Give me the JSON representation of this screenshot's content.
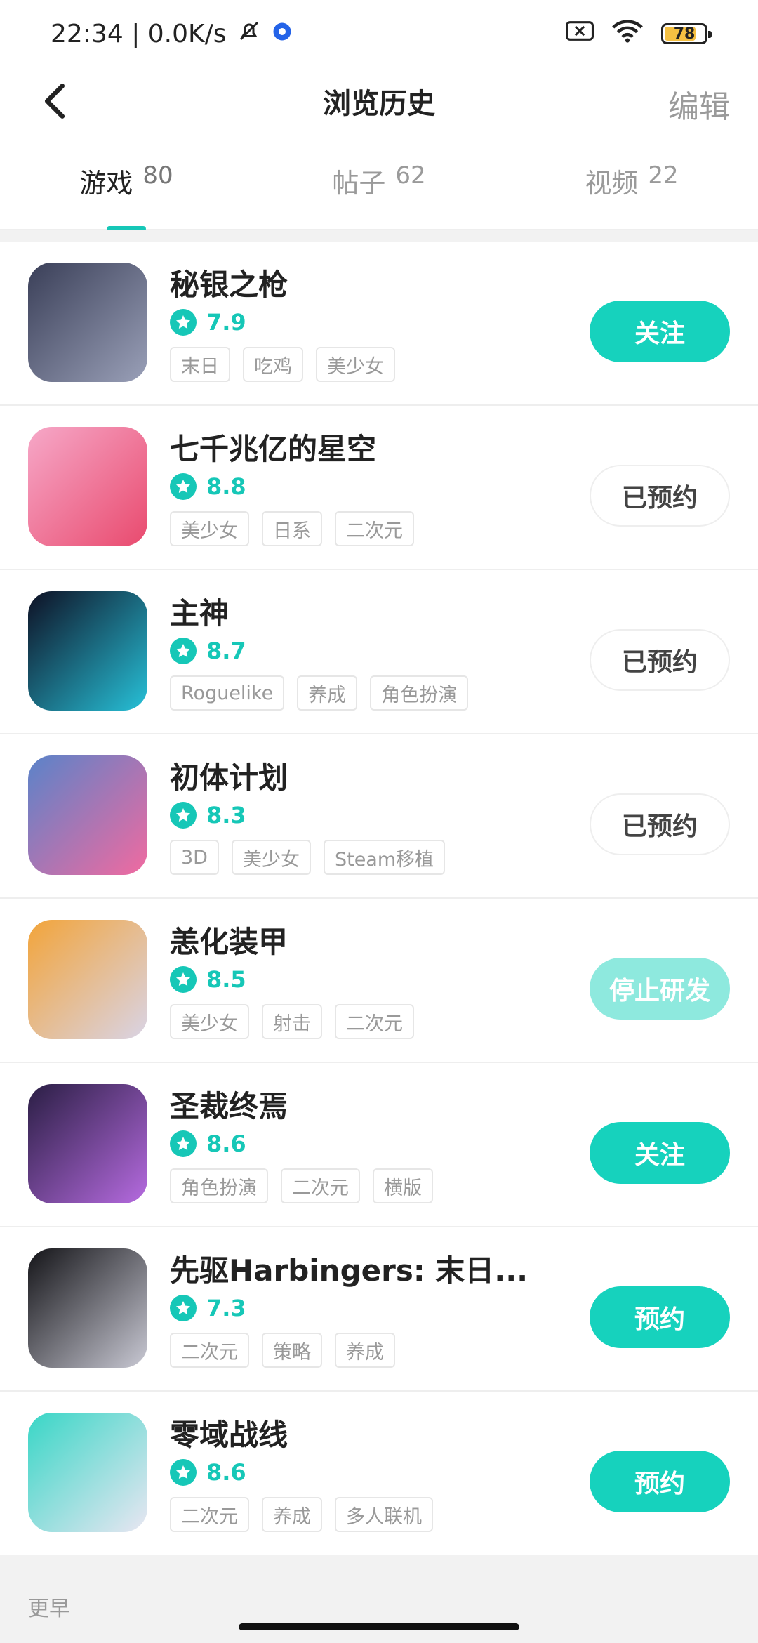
{
  "status_bar": {
    "time_speed": "22:34 | 0.0K/s",
    "battery_level": "78",
    "battery_fraction": 0.78
  },
  "nav": {
    "title": "浏览历史",
    "edit_label": "编辑"
  },
  "tabs": [
    {
      "label": "游戏",
      "count": "80"
    },
    {
      "label": "帖子",
      "count": "62"
    },
    {
      "label": "视频",
      "count": "22"
    }
  ],
  "games": [
    {
      "name": "秘银之枪",
      "rating": "7.9",
      "tags": [
        "末日",
        "吃鸡",
        "美少女"
      ],
      "action": "关注",
      "action_style": "primary",
      "icon_colors": [
        "#3a3f58",
        "#9aa0b8"
      ]
    },
    {
      "name": "七千兆亿的星空",
      "rating": "8.8",
      "tags": [
        "美少女",
        "日系",
        "二次元"
      ],
      "action": "已预约",
      "action_style": "reserved",
      "icon_colors": [
        "#f6a8c8",
        "#e94a6e"
      ]
    },
    {
      "name": "主神",
      "rating": "8.7",
      "tags": [
        "Roguelike",
        "养成",
        "角色扮演"
      ],
      "action": "已预约",
      "action_style": "reserved",
      "icon_colors": [
        "#0e1024",
        "#27c1d8"
      ]
    },
    {
      "name": "初体计划",
      "rating": "8.3",
      "tags": [
        "3D",
        "美少女",
        "Steam移植"
      ],
      "action": "已预约",
      "action_style": "reserved",
      "icon_colors": [
        "#5a83c9",
        "#f16aa0"
      ]
    },
    {
      "name": "恙化装甲",
      "rating": "8.5",
      "tags": [
        "美少女",
        "射击",
        "二次元"
      ],
      "action": "停止研发",
      "action_style": "faded",
      "icon_colors": [
        "#f2a43a",
        "#d9d4e6"
      ]
    },
    {
      "name": "圣裁终焉",
      "rating": "8.6",
      "tags": [
        "角色扮演",
        "二次元",
        "横版"
      ],
      "action": "关注",
      "action_style": "primary",
      "icon_colors": [
        "#2a1e44",
        "#b66be0"
      ]
    },
    {
      "name": "先驱Harbingers: 末日...",
      "rating": "7.3",
      "tags": [
        "二次元",
        "策略",
        "养成"
      ],
      "action": "预约",
      "action_style": "primary",
      "icon_colors": [
        "#141418",
        "#c9c9d4"
      ]
    },
    {
      "name": "零域战线",
      "rating": "8.6",
      "tags": [
        "二次元",
        "养成",
        "多人联机"
      ],
      "action": "预约",
      "action_style": "primary",
      "icon_colors": [
        "#38d6c6",
        "#e9e6f2"
      ]
    }
  ],
  "section_earlier": "更早"
}
